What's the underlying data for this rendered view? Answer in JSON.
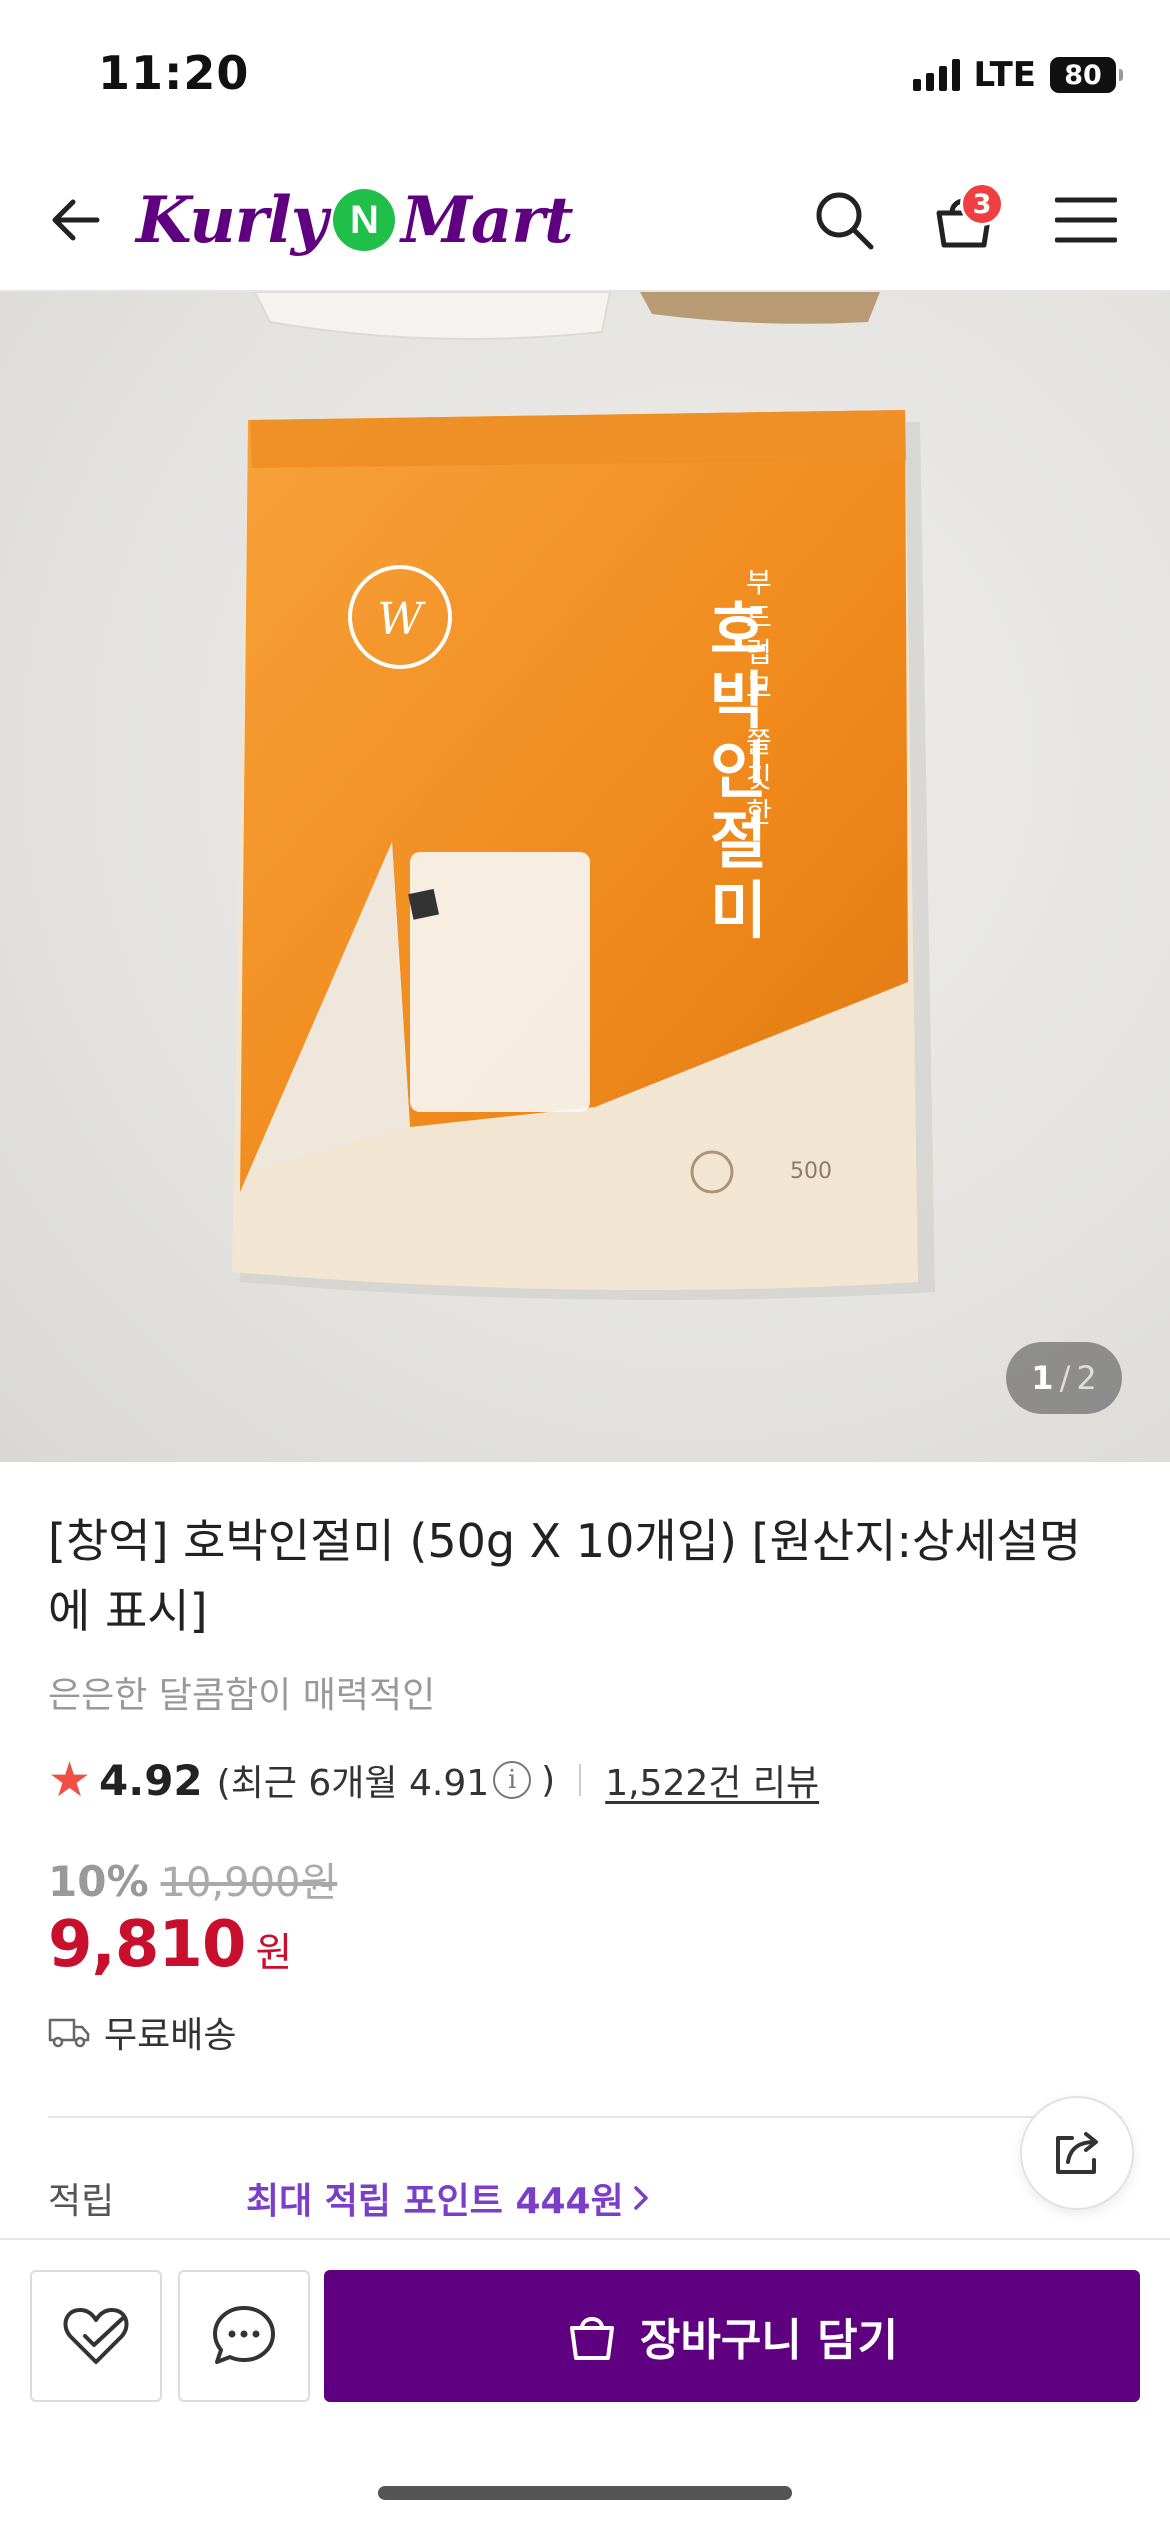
{
  "status_bar": {
    "time": "11:20",
    "network": "LTE",
    "battery": "80"
  },
  "header": {
    "logo_left": "Kurly",
    "logo_badge": "N",
    "logo_right": "Mart",
    "cart_count": "3",
    "icons": [
      "back-arrow-icon",
      "search-icon",
      "cart-icon",
      "menu-icon"
    ]
  },
  "product_image": {
    "current": "1",
    "separator": "/",
    "total": "2"
  },
  "product": {
    "title": "[창억] 호박인절미 (50g X 10개입) [원산지:상세설명에 표시]",
    "subtitle": "은은한 달콤함이 매력적인",
    "rating": "4.92",
    "rating_recent_prefix": "(최근 6개월 4.91",
    "rating_recent_suffix": ")",
    "review_link": "1,522건 리뷰",
    "discount_rate": "10%",
    "original_price": "10,900원",
    "sale_price": "9,810",
    "sale_unit": "원",
    "delivery": "무료배송"
  },
  "points": {
    "label": "적립",
    "value": "최대 적립 포인트 444원"
  },
  "bottom_bar": {
    "add_to_cart": "장바구니 담기"
  },
  "colors": {
    "brand_purple": "#5f0080",
    "price_red": "#c8102e",
    "points_purple": "#7a3ec8",
    "star": "#f04f45",
    "badge_red": "#f03f40",
    "logo_green": "#1fbf4a",
    "bag_orange": "#f5962a"
  }
}
